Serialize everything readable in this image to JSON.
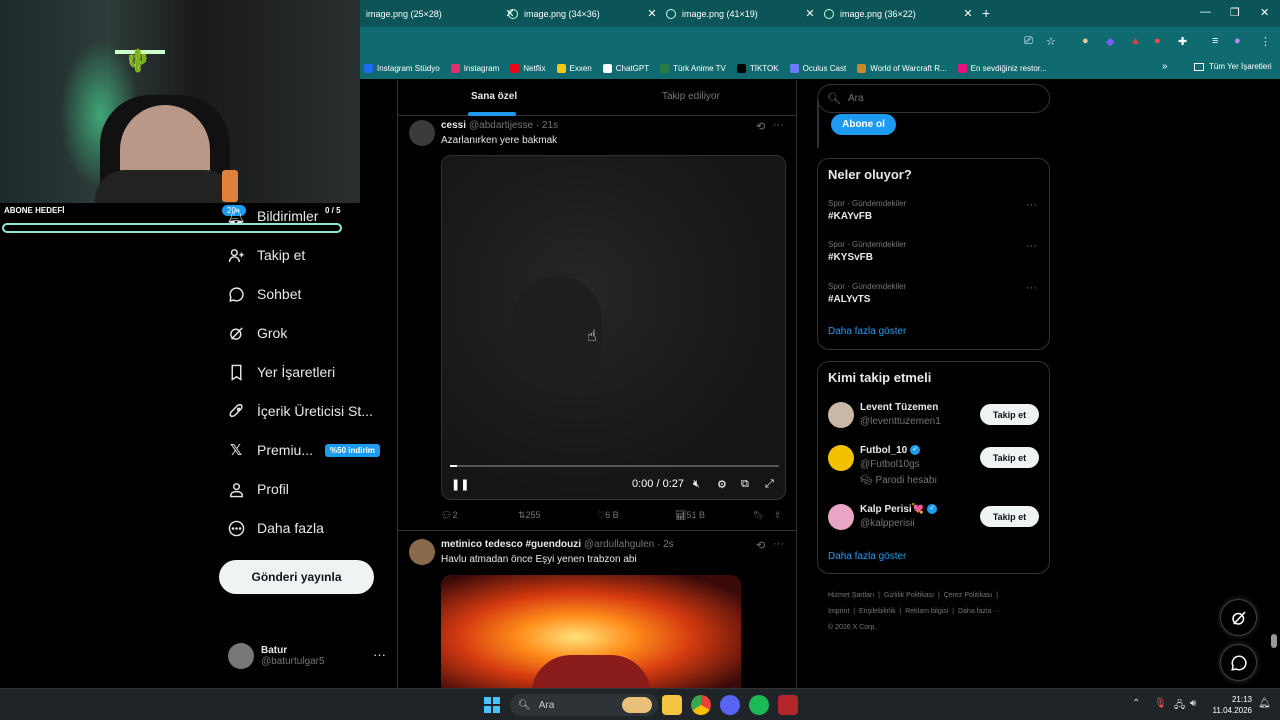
{
  "browser": {
    "tabs": [
      {
        "title": "image.png (25×28)"
      },
      {
        "title": "image.png (34×36)"
      },
      {
        "title": "image.png (41×19)"
      },
      {
        "title": "image.png (36×22)"
      }
    ],
    "bookmarks": [
      {
        "label": "Instagram Stüdyo",
        "color": "#1d6bf0"
      },
      {
        "label": "Instagram",
        "color": "#e1306c"
      },
      {
        "label": "Netflix",
        "color": "#e50914"
      },
      {
        "label": "Exxen",
        "color": "#f5c518"
      },
      {
        "label": "ChatGPT",
        "color": "#ffffff"
      },
      {
        "label": "Türk Anime TV",
        "color": "#2b7a3f"
      },
      {
        "label": "TİKTOK",
        "color": "#000000"
      },
      {
        "label": "Oculus Cast",
        "color": "#6c7bff"
      },
      {
        "label": "World of Warcraft R...",
        "color": "#c68b2c"
      },
      {
        "label": "En sevdiğiniz restor...",
        "color": "#e3137b"
      }
    ],
    "all_bookmarks": "Tüm Yer İşaretleri"
  },
  "webcam": {
    "abone_label": "ABONE HEDEFİ",
    "abone_count": "0 / 5",
    "abone_progress": 0,
    "notif_badge": "20+"
  },
  "nav": {
    "items": [
      {
        "label": "Bildirimler",
        "icon": "bell-icon"
      },
      {
        "label": "Takip et",
        "icon": "add-user-icon"
      },
      {
        "label": "Sohbet",
        "icon": "chat-icon"
      },
      {
        "label": "Grok",
        "icon": "grok-icon"
      },
      {
        "label": "Yer İşaretleri",
        "icon": "bookmark-icon"
      },
      {
        "label": "İçerik Üreticisi St...",
        "icon": "rocket-icon"
      },
      {
        "label": "Premiu...",
        "icon": "x-logo-icon"
      },
      {
        "label": "Profil",
        "icon": "person-icon"
      },
      {
        "label": "Daha fazla",
        "icon": "more-circle-icon"
      }
    ],
    "premium_badge": "%50 indirim",
    "post_button": "Gönderi yayınla",
    "account": {
      "name": "Batur",
      "handle": "@baturtulgar5"
    }
  },
  "timeline": {
    "tabs": [
      {
        "label": "Sana özel"
      },
      {
        "label": "Takip ediliyor"
      }
    ],
    "tweets": [
      {
        "name": "cessi",
        "handle": "@abdartijesse · 21s",
        "text": "Azarlanırken yere bakmak",
        "video_time": "0:00 / 0:27",
        "video_progress": 0.02,
        "replies": "2",
        "retweets": "255",
        "likes": "6 B",
        "views": "51 B"
      },
      {
        "name": "metinico tedesco #guendouzi",
        "handle": "@ardullahgulen · 2s",
        "text": "Havlu atmadan önce Eşyi yenen trabzon abi"
      }
    ]
  },
  "sidebar": {
    "search_placeholder": "Ara",
    "subscribe_button": "Abone ol",
    "trends_title": "Neler oluyor?",
    "trends": [
      {
        "category": "Spor · Gündemdekiler",
        "tag": "#KAYvFB"
      },
      {
        "category": "Spor · Gündemdekiler",
        "tag": "#KYSvFB"
      },
      {
        "category": "Spor · Gündemdekiler",
        "tag": "#ALYvTS"
      }
    ],
    "show_more": "Daha fazla göster",
    "who_title": "Kimi takip etmeli",
    "who": [
      {
        "name": "Levent Tüzemen",
        "handle": "@leventtuzemen1",
        "sub": "",
        "verified": false,
        "button": "Takip et",
        "avatar_color": "#c9b8a6"
      },
      {
        "name": "Futbol_10",
        "handle": "@Futbol10gs",
        "sub": "Parodi hesabı",
        "verified": true,
        "button": "Takip et",
        "avatar_color": "#f2c200"
      },
      {
        "name": "Kalp Perisi💘",
        "handle": "@kalpperisii",
        "sub": "",
        "verified": true,
        "button": "Takip et",
        "avatar_color": "#e8a5c4"
      }
    ],
    "who_show_more": "Daha fazla göster",
    "footer": [
      "Hizmet Şartları",
      "Gizlilik Politikası",
      "Çerez Politikası",
      "İmprint",
      "Erişilebilirlik",
      "Reklam bilgisi",
      "Daha fazla ···",
      "© 2026 X Corp."
    ]
  },
  "taskbar": {
    "search_label": "Ara",
    "time": "21:13",
    "date": "11.04.2026"
  }
}
